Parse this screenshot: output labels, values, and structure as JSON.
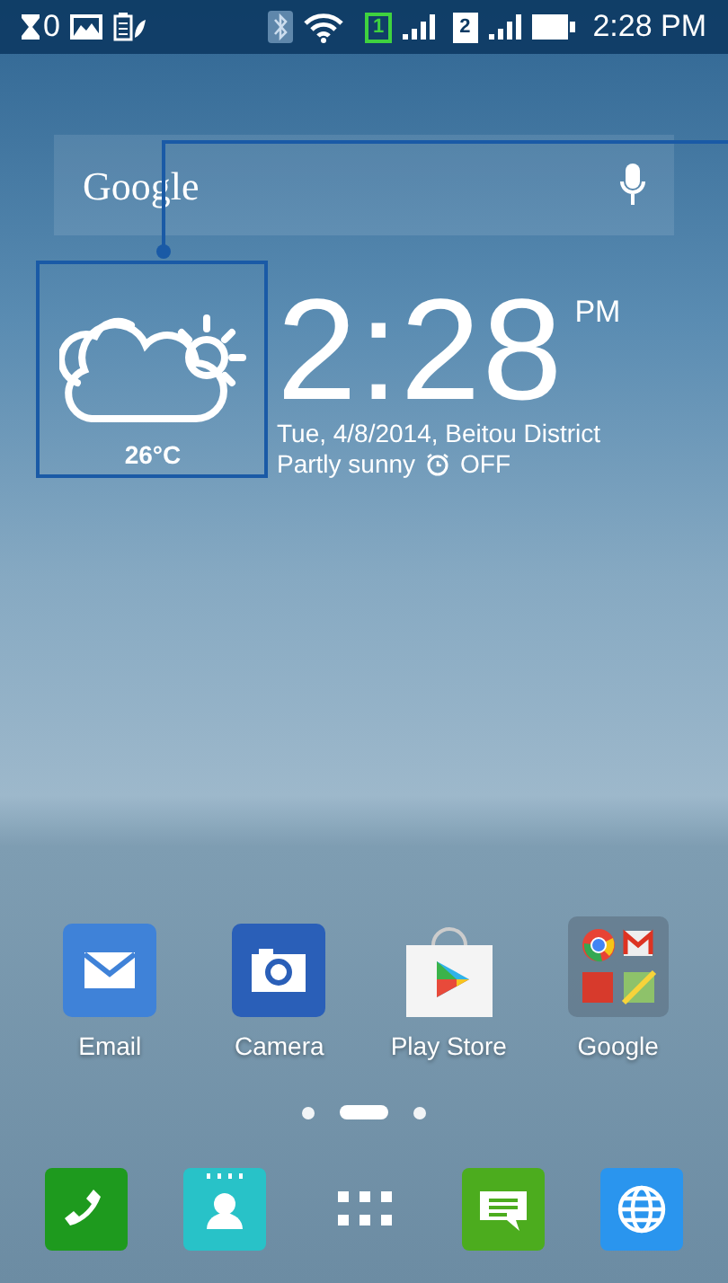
{
  "status_bar": {
    "notification_count": "0",
    "sim_1": "1",
    "sim_2": "2",
    "time": "2:28 PM"
  },
  "search_widget": {
    "logo": "Google"
  },
  "weather_widget": {
    "temperature": "26°C",
    "time": "2:28",
    "meridiem": "PM",
    "date_location": "Tue, 4/8/2014, Beitou District",
    "condition": "Partly sunny",
    "alarm": "OFF"
  },
  "apps": [
    {
      "kind": "email",
      "label": "Email"
    },
    {
      "kind": "camera",
      "label": "Camera"
    },
    {
      "kind": "store",
      "label": "Play Store"
    },
    {
      "kind": "folder",
      "label": "Google"
    }
  ],
  "page_indicator": [
    {
      "selected": false
    },
    {
      "selected": true
    },
    {
      "selected": false
    }
  ],
  "dock": [
    {
      "kind": "phone"
    },
    {
      "kind": "contacts"
    },
    {
      "kind": "apps"
    },
    {
      "kind": "messages"
    },
    {
      "kind": "browser"
    }
  ]
}
